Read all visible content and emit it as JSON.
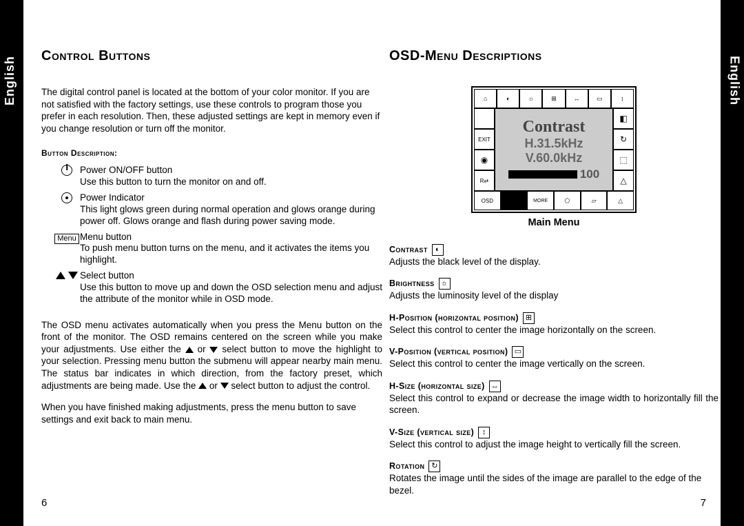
{
  "tabs": {
    "left": "English",
    "right": "English"
  },
  "left": {
    "title": "Control Buttons",
    "intro": "The digital control panel is located at the bottom of your color monitor. If you are not satisfied with the factory settings, use these controls to program those you prefer in each resolution. Then, these adjusted settings are kept in memory even if you change resolution or turn off the monitor.",
    "subhead": "Button Description:",
    "buttons": [
      {
        "label": "Power ON/OFF button",
        "desc": "Use this button to turn the monitor on and off."
      },
      {
        "label": "Power Indicator",
        "desc": "This light glows green during normal operation and glows orange during power off. Glows orange and flash during power saving mode."
      },
      {
        "label": "Menu button",
        "desc": "To push menu button turns on the menu, and it activates the items you highlight."
      },
      {
        "label": "Select button",
        "desc": "Use this button to move up and down the OSD selection menu and adjust the attribute of the monitor while in OSD mode."
      }
    ],
    "para1a": "The OSD menu activates automatically when you press the Menu button on the front of the monitor. The OSD remains centered on the screen while you make your adjustments. Use either the ",
    "para1b": " or ",
    "para1c": " select button to move the highlight to your selection. Pressing menu button the submenu will appear nearby main menu. The status bar indicates in which direction, from the factory preset, which adjustments are being made. Use the ",
    "para1d": " or ",
    "para1e": " select button to adjust the control.",
    "para2": "When you have finished making adjustments, press the menu button to save settings and exit back to main menu.",
    "pagenum": "6"
  },
  "right": {
    "title": "OSD-Menu Descriptions",
    "osd": {
      "title": "Contrast",
      "freq1": "H.31.5kHz",
      "freq2": "V.60.0kHz",
      "value": "100",
      "left_labels": [
        "",
        "EXIT",
        "",
        "R⇄"
      ],
      "bottom_labels": [
        "OSD",
        "▮",
        "MORE",
        "",
        "",
        ""
      ]
    },
    "main_menu_caption": "Main Menu",
    "items": [
      {
        "label": "Contrast",
        "desc": "Adjusts the black level of the display."
      },
      {
        "label": "Brightness",
        "desc": "Adjusts the luminosity level of the display"
      },
      {
        "label": "H-Position (horizontal position)",
        "desc": "Select this control to center the image horizontally on the screen."
      },
      {
        "label": "V-Position (vertical position)",
        "desc": "Select this control to center the image vertically on the screen."
      },
      {
        "label": "H-Size (horizontal size)",
        "desc": "Select this control to expand or decrease the image width to horizontally fill the screen."
      },
      {
        "label": "V-Size (vertical size)",
        "desc": "Select this control to adjust the image height to vertically fill the screen."
      },
      {
        "label": "Rotation",
        "desc": "Rotates the image until the sides of the image are parallel to the edge of the bezel."
      }
    ],
    "pagenum": "7"
  }
}
